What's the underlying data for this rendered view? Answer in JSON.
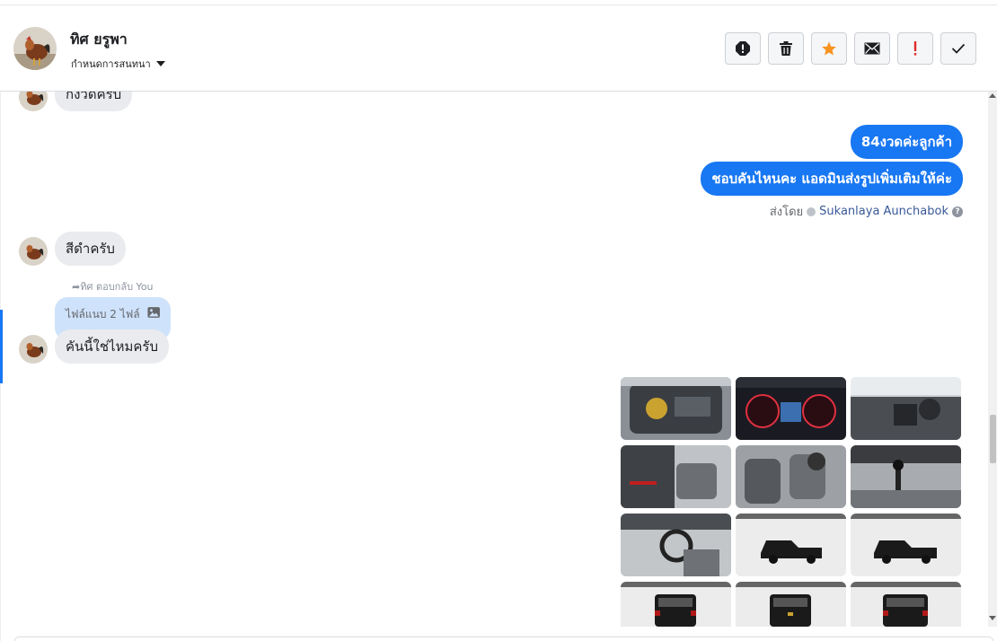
{
  "header": {
    "name": "ทิศ ยรูพา",
    "subtitle": "กำหนดการสนทนา"
  },
  "toolbar": {
    "icons": [
      "spam-icon",
      "trash-icon",
      "star-icon",
      "envelope-icon",
      "exclamation-icon",
      "check-icon"
    ],
    "star_color": "#f7931e",
    "exclamation_color": "#e02a2a"
  },
  "messages": {
    "in_1": "กี่งวดครับ",
    "out_1": "84งวดค่ะลูกค้า",
    "out_2": "ชอบคันไหนคะ แอดมินส่งรูปเพิ่มเติมให้ค่ะ",
    "sent_by_label": "ส่งโดย",
    "agent_name": "Sukanlaya Aunchabok",
    "in_2": "สีดำครับ",
    "replied_label": "ทิศ ตอบกลับ You",
    "quote_text": "ไฟล์แนบ 2 ไฟล์",
    "in_3": "คันนี้ใช่ไหมครับ"
  },
  "gallery": {
    "photos": [
      "engine-bay",
      "dashboard-gauges",
      "interior-dash",
      "door-interior",
      "front-seats",
      "gear-shifter",
      "steering-wheel",
      "truck-side",
      "truck-side-2",
      "truck-rear",
      "truck-rear-2",
      "truck-rear-3"
    ]
  },
  "colors": {
    "accent": "#1877f2",
    "bubble_in": "#e9ebee",
    "quote_bg": "#cfe2fb"
  }
}
